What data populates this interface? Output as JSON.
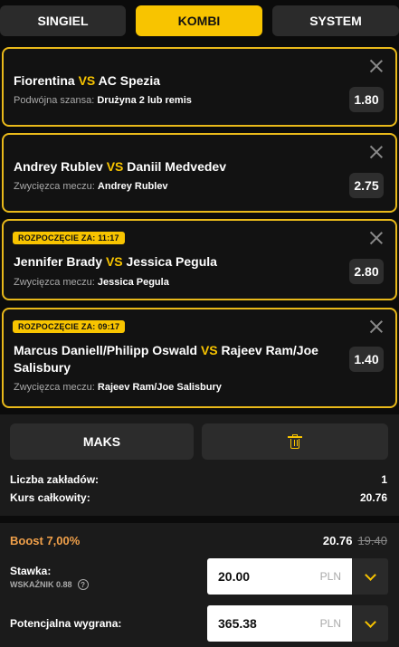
{
  "tabs": [
    {
      "label": "SINGIEL",
      "active": false
    },
    {
      "label": "KOMBI",
      "active": true
    },
    {
      "label": "SYSTEM",
      "active": false
    }
  ],
  "bets": [
    {
      "badge": "",
      "home": "Fiorentina",
      "vs": "VS",
      "away": "AC Spezia",
      "market_label": "Podwójna szansa:",
      "selection": "Drużyna 2 lub remis",
      "odds": "1.80"
    },
    {
      "badge": "",
      "home": "Andrey Rublev",
      "vs": "VS",
      "away": "Daniil Medvedev",
      "market_label": "Zwycięzca meczu:",
      "selection": "Andrey Rublev",
      "odds": "2.75"
    },
    {
      "badge": "ROZPOCZĘCIE ZA: 11:17",
      "home": "Jennifer Brady",
      "vs": "VS",
      "away": "Jessica Pegula",
      "market_label": "Zwycięzca meczu:",
      "selection": "Jessica Pegula",
      "odds": "2.80"
    },
    {
      "badge": "ROZPOCZĘCIE ZA: 09:17",
      "home": "Marcus Daniell/Philipp Oswald",
      "vs": "VS",
      "away": "Rajeev Ram/Joe Salisbury",
      "market_label": "Zwycięzca meczu:",
      "selection": "Rajeev Ram/Joe Salisbury",
      "odds": "1.40"
    }
  ],
  "summary": {
    "maks_label": "MAKS",
    "bets_count_label": "Liczba zakładów:",
    "bets_count": "1",
    "total_odds_label": "Kurs całkowity:",
    "total_odds": "20.76"
  },
  "stake": {
    "boost_label": "Boost 7,00%",
    "boosted_odds": "20.76",
    "old_odds": "19.40",
    "stake_label": "Stawka:",
    "indicator_label": "WSKAŹNIK 0.88",
    "stake_value": "20.00",
    "currency": "PLN",
    "win_label": "Potencjalna wygrana:",
    "win_value": "365.38"
  },
  "colors": {
    "accent": "#f8c400",
    "boost": "#f0a04a",
    "card_bg": "#121212",
    "panel_bg": "#1b1b1b"
  }
}
